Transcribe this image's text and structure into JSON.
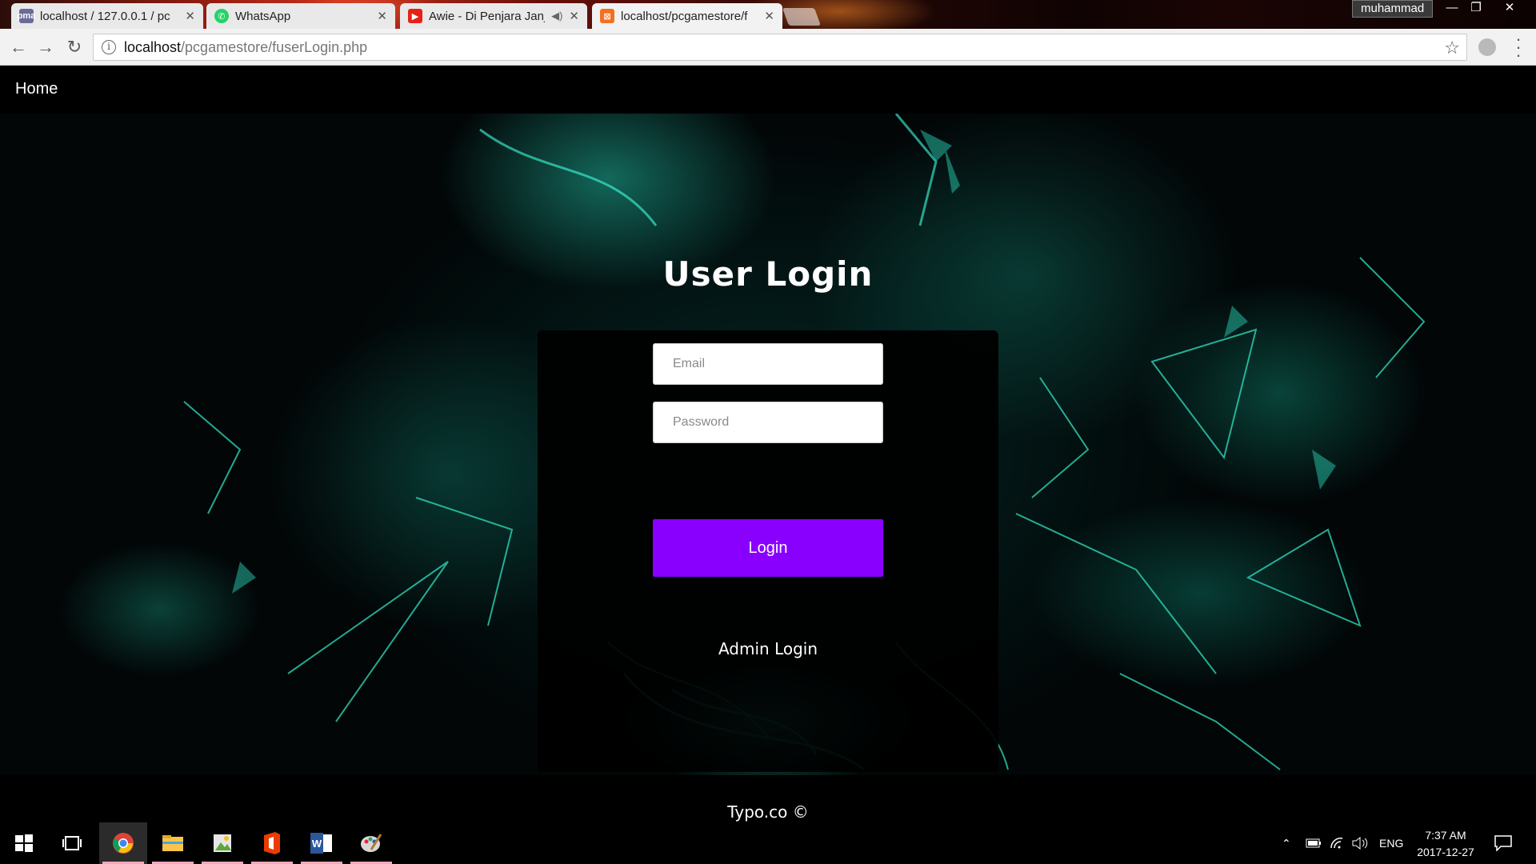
{
  "browser": {
    "tabs": [
      {
        "title": "localhost / 127.0.0.1 / pc",
        "favicon": "phpmyadmin-icon",
        "state": "inactive"
      },
      {
        "title": "WhatsApp",
        "favicon": "whatsapp-icon",
        "state": "inactive"
      },
      {
        "title": "Awie - Di Penjara Janj",
        "favicon": "youtube-icon",
        "state": "inactive",
        "audio": true
      },
      {
        "title": "localhost/pcgamestore/f",
        "favicon": "xampp-icon",
        "state": "active"
      }
    ],
    "profile_name": "muhammad",
    "address": {
      "host": "localhost",
      "path": "/pcgamestore/fuserLogin.php"
    }
  },
  "page": {
    "nav": {
      "home_label": "Home"
    },
    "login": {
      "title": "User Login",
      "email_placeholder": "Email",
      "password_placeholder": "Password",
      "button_label": "Login",
      "admin_link_label": "Admin Login"
    },
    "footer": "Typo.co ©",
    "accent_color": "#8a00ff"
  },
  "taskbar": {
    "apps": [
      "windows-start",
      "task-view",
      "chrome",
      "file-explorer",
      "image-viewer",
      "office",
      "word",
      "paint"
    ],
    "tray": {
      "language": "ENG",
      "time": "7:37 AM",
      "date": "2017-12-27"
    }
  }
}
